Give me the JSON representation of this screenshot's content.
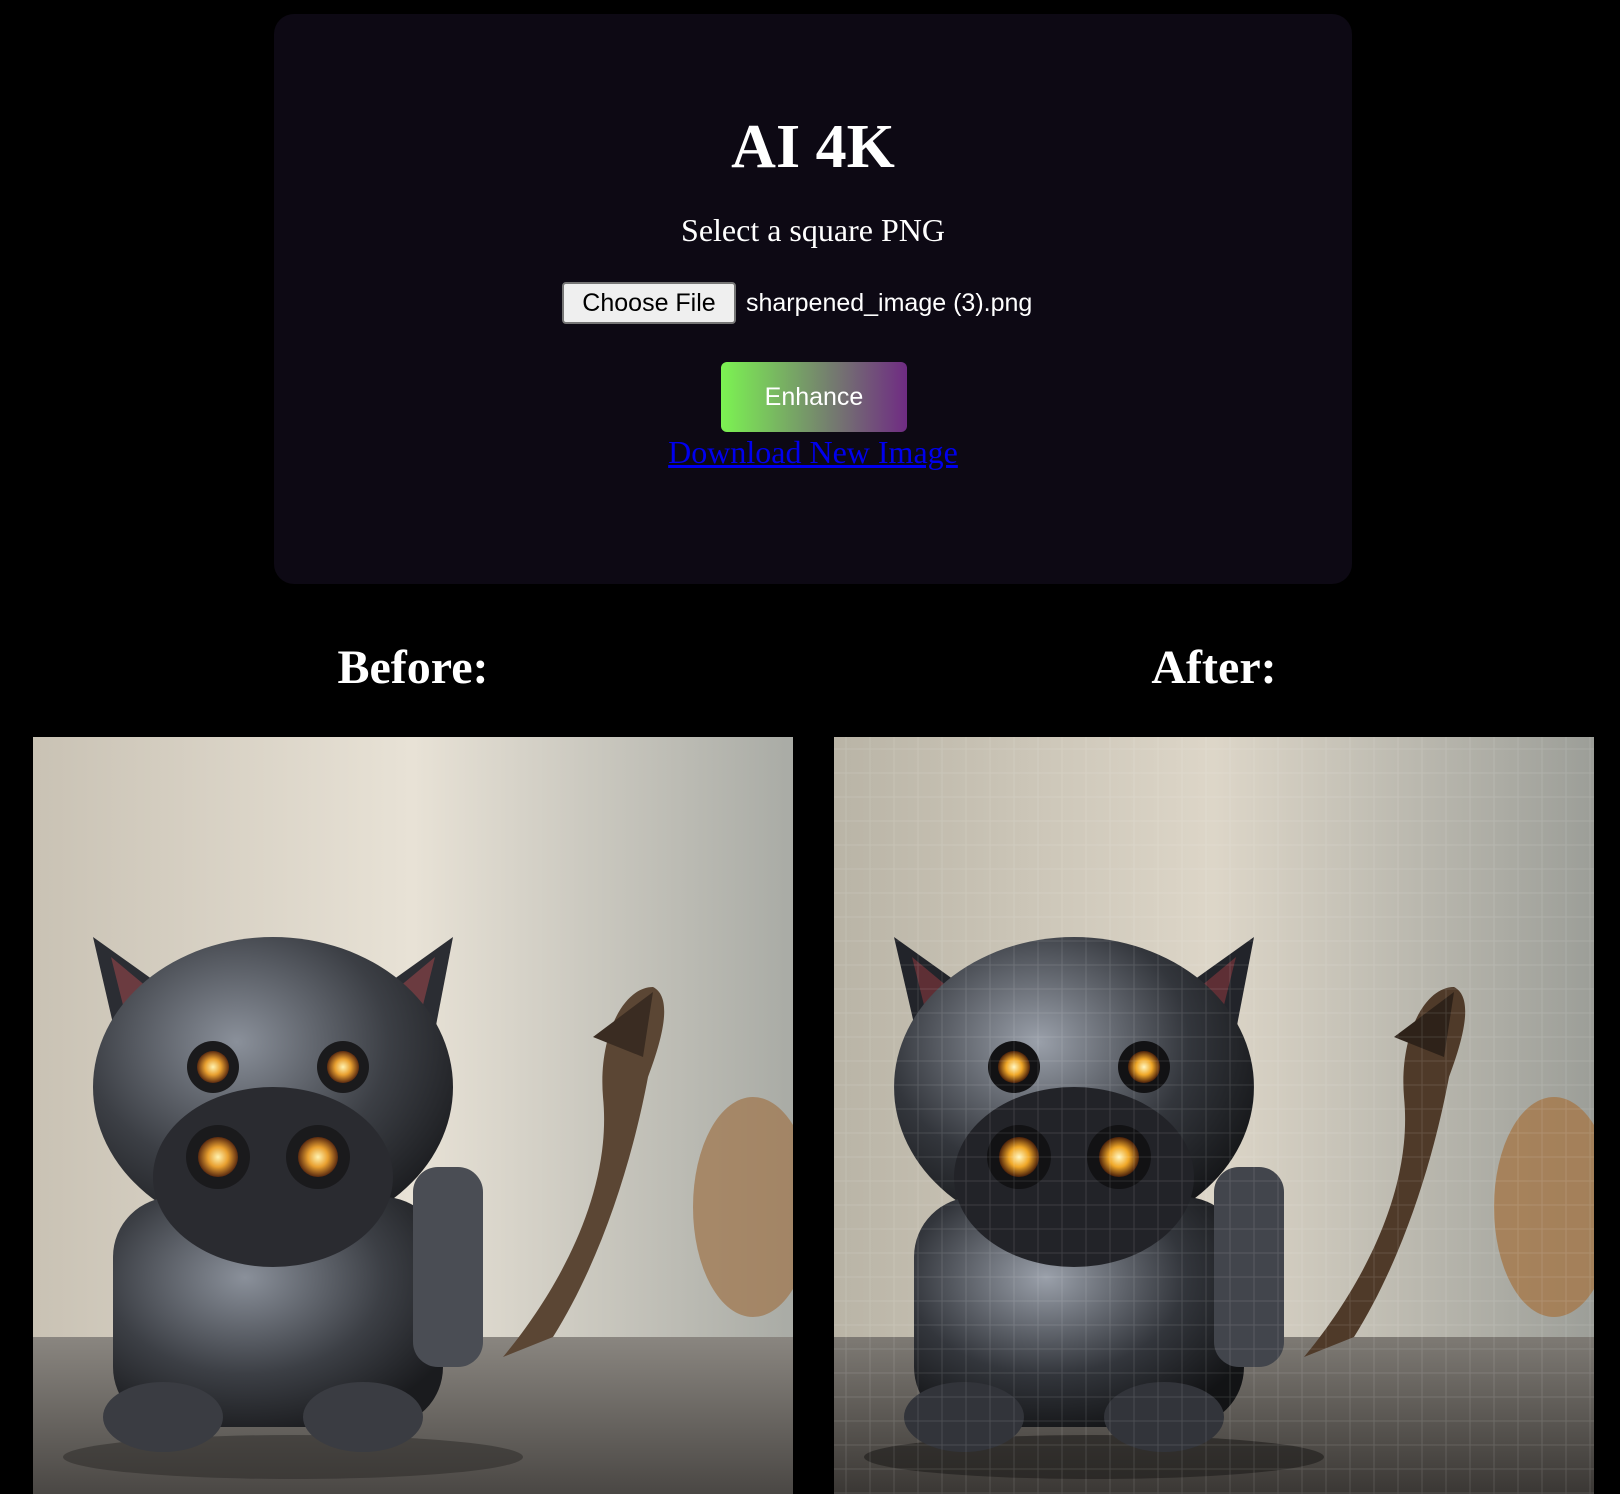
{
  "app": {
    "title": "AI 4K",
    "subtitle": "Select a square PNG"
  },
  "file_input": {
    "button_label": "Choose File",
    "selected_file": "sharpened_image (3).png"
  },
  "actions": {
    "enhance_label": "Enhance",
    "download_label": "Download New Image"
  },
  "comparison": {
    "before_label": "Before:",
    "after_label": "After:",
    "before_image": "robot-cat-photo-original",
    "after_image": "robot-cat-photo-enhanced"
  },
  "colors": {
    "page_background": "#000000",
    "card_background": "#0d0914",
    "enhance_gradient_start": "#7cf352",
    "enhance_gradient_end": "#6f2b83",
    "link": "#0000ee"
  }
}
